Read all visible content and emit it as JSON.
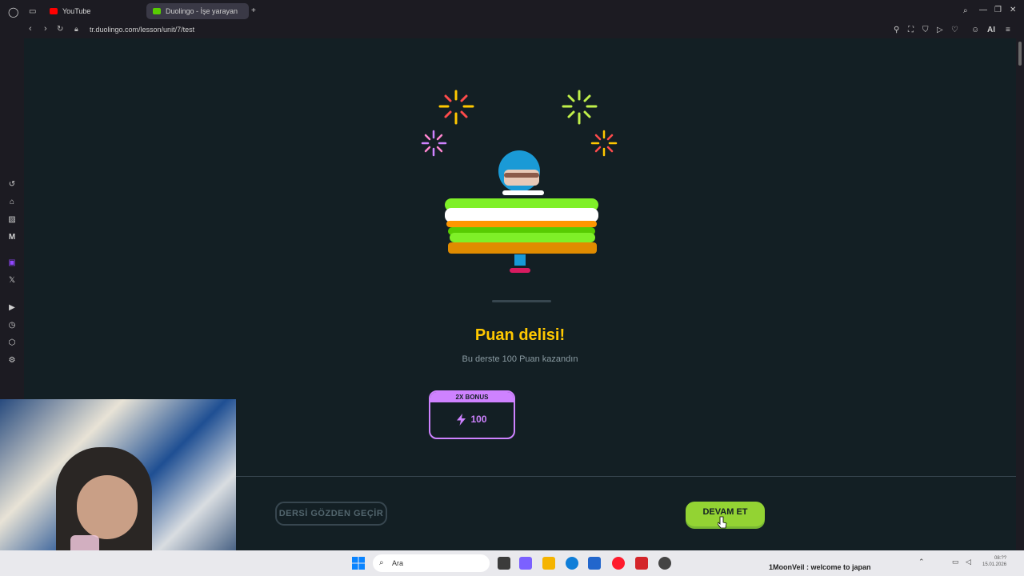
{
  "browser": {
    "tabs": [
      {
        "label": "YouTube"
      },
      {
        "label": "Duolingo - İşe yarayan"
      }
    ],
    "new_tab": "+",
    "url": "tr.duolingo.com/lesson/unit/7/test",
    "ai_label": "AI"
  },
  "lesson": {
    "title": "Puan delisi!",
    "subtitle": "Bu derste 100 Puan kazandın",
    "bonus_label": "2X BONUS",
    "bonus_value": "100",
    "review_button": "DERSİ GÖZDEN GEÇİR",
    "continue_button": "DEVAM ET"
  },
  "taskbar": {
    "search_placeholder": "Ara",
    "stream_text": "1MoonVeil : welcome to japan",
    "time": "08:??",
    "date": "15.01.2026"
  },
  "colors": {
    "accent_yellow": "#ffc800",
    "bonus_purple": "#ce82ff",
    "continue_green": "#93d333",
    "background": "#131f24"
  }
}
